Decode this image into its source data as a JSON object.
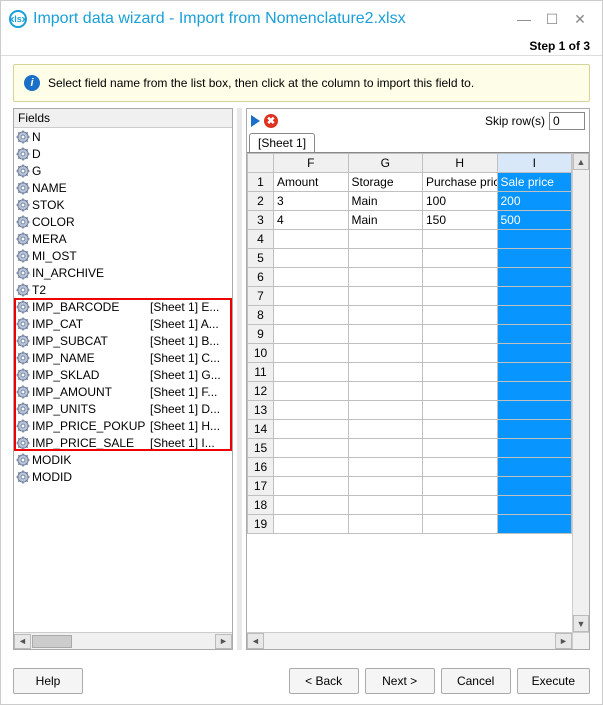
{
  "window": {
    "title": "Import data wizard - Import from Nomenclature2.xlsx",
    "step_label": "Step 1 of 3"
  },
  "info": {
    "text": "Select field name from the list box, then click at the column to import this field to."
  },
  "fields": {
    "header": "Fields",
    "items": [
      {
        "name": "N",
        "map": ""
      },
      {
        "name": "D",
        "map": ""
      },
      {
        "name": "G",
        "map": ""
      },
      {
        "name": "NAME",
        "map": ""
      },
      {
        "name": "STOK",
        "map": ""
      },
      {
        "name": "COLOR",
        "map": ""
      },
      {
        "name": "MERA",
        "map": ""
      },
      {
        "name": "MI_OST",
        "map": ""
      },
      {
        "name": "IN_ARCHIVE",
        "map": ""
      },
      {
        "name": "T2",
        "map": ""
      },
      {
        "name": "IMP_BARCODE",
        "map": "[Sheet 1] E..."
      },
      {
        "name": "IMP_CAT",
        "map": "[Sheet 1] A..."
      },
      {
        "name": "IMP_SUBCAT",
        "map": "[Sheet 1] B..."
      },
      {
        "name": "IMP_NAME",
        "map": "[Sheet 1] C..."
      },
      {
        "name": "IMP_SKLAD",
        "map": "[Sheet 1] G..."
      },
      {
        "name": "IMP_AMOUNT",
        "map": "[Sheet 1] F..."
      },
      {
        "name": "IMP_UNITS",
        "map": "[Sheet 1] D..."
      },
      {
        "name": "IMP_PRICE_POKUP",
        "map": "[Sheet 1] H..."
      },
      {
        "name": "IMP_PRICE_SALE",
        "map": "[Sheet 1] I..."
      },
      {
        "name": "MODIK",
        "map": ""
      },
      {
        "name": "MODID",
        "map": ""
      }
    ]
  },
  "toolbar": {
    "skip_label": "Skip row(s)",
    "skip_value": "0"
  },
  "sheet": {
    "tab": "[Sheet 1]",
    "columns": [
      "F",
      "G",
      "H",
      "I"
    ],
    "selected_col_index": 3,
    "rows": [
      [
        "Amount",
        "Storage",
        "Purchase price",
        "Sale price"
      ],
      [
        "3",
        "Main",
        "100",
        "200"
      ],
      [
        "4",
        "Main",
        "150",
        "500"
      ],
      [
        "",
        "",
        "",
        ""
      ],
      [
        "",
        "",
        "",
        ""
      ],
      [
        "",
        "",
        "",
        ""
      ],
      [
        "",
        "",
        "",
        ""
      ],
      [
        "",
        "",
        "",
        ""
      ],
      [
        "",
        "",
        "",
        ""
      ],
      [
        "",
        "",
        "",
        ""
      ],
      [
        "",
        "",
        "",
        ""
      ],
      [
        "",
        "",
        "",
        ""
      ],
      [
        "",
        "",
        "",
        ""
      ],
      [
        "",
        "",
        "",
        ""
      ],
      [
        "",
        "",
        "",
        ""
      ],
      [
        "",
        "",
        "",
        ""
      ],
      [
        "",
        "",
        "",
        ""
      ],
      [
        "",
        "",
        "",
        ""
      ],
      [
        "",
        "",
        "",
        ""
      ]
    ]
  },
  "buttons": {
    "help": "Help",
    "back": "< Back",
    "next": "Next >",
    "cancel": "Cancel",
    "execute": "Execute"
  }
}
